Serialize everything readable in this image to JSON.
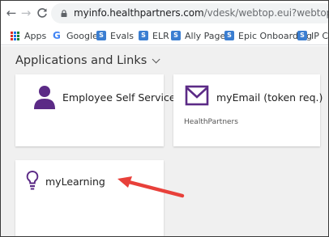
{
  "browser": {
    "nav": {
      "back_icon": "arrow-left-icon",
      "forward_icon": "arrow-right-icon",
      "reload_icon": "reload-icon"
    },
    "url_host": "myinfo.healthpartners.com",
    "url_path": "/vdesk/webtop.eui?webtop=/Common/m",
    "bookmarks": [
      {
        "label": "Apps",
        "icon": "apps-grid-icon"
      },
      {
        "label": "Google",
        "icon": "google-icon"
      },
      {
        "label": "Evals",
        "icon": "sharepoint-icon"
      },
      {
        "label": "ELR",
        "icon": "sharepoint-icon"
      },
      {
        "label": "Ally Page",
        "icon": "sharepoint-icon"
      },
      {
        "label": "Epic Onboarding",
        "icon": "sharepoint-icon"
      },
      {
        "label": "IP Clin",
        "icon": "sharepoint-icon"
      }
    ]
  },
  "section": {
    "title": "Applications and Links"
  },
  "tiles": [
    {
      "label": "Employee Self Service",
      "icon": "person-icon"
    },
    {
      "label": "myEmail (token req.)",
      "sublabel": "HealthPartners",
      "icon": "envelope-icon"
    },
    {
      "label": "myLearning",
      "icon": "lightbulb-icon"
    }
  ],
  "colors": {
    "accent_purple": "#5b2a86",
    "arrow_red": "#e8403a",
    "page_bg": "#f0f0f0",
    "sharepoint_blue": "#3b7ed1"
  }
}
